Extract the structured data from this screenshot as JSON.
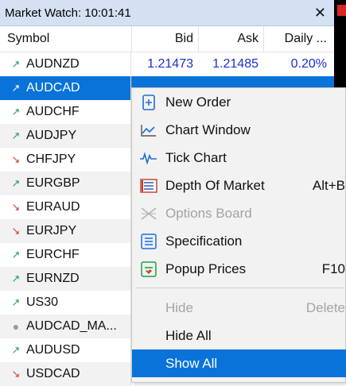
{
  "window": {
    "title": "Market Watch: 10:01:41",
    "close_icon": "close-icon"
  },
  "columns": {
    "symbol": "Symbol",
    "bid": "Bid",
    "ask": "Ask",
    "daily": "Daily ..."
  },
  "rows": [
    {
      "symbol": "AUDNZD",
      "dir": "up",
      "bid": "1.21473",
      "ask": "1.21485",
      "daily": "0.20%"
    },
    {
      "symbol": "AUDCAD",
      "dir": "up",
      "bid": "",
      "ask": "",
      "daily": "",
      "selected": true
    },
    {
      "symbol": "AUDCHF",
      "dir": "up"
    },
    {
      "symbol": "AUDJPY",
      "dir": "up"
    },
    {
      "symbol": "CHFJPY",
      "dir": "down"
    },
    {
      "symbol": "EURGBP",
      "dir": "up"
    },
    {
      "symbol": "EURAUD",
      "dir": "down"
    },
    {
      "symbol": "EURJPY",
      "dir": "down"
    },
    {
      "symbol": "EURCHF",
      "dir": "up"
    },
    {
      "symbol": "EURNZD",
      "dir": "up"
    },
    {
      "symbol": "US30",
      "dir": "up"
    },
    {
      "symbol": "AUDCAD_MA...",
      "dir": "none"
    },
    {
      "symbol": "AUDUSD",
      "dir": "up"
    },
    {
      "symbol": "USDCAD",
      "dir": "down"
    }
  ],
  "context_menu": {
    "items": [
      {
        "label": "New Order",
        "shortcut": "",
        "icon": "new-order-icon",
        "disabled": false
      },
      {
        "label": "Chart Window",
        "shortcut": "",
        "icon": "chart-window-icon",
        "disabled": false
      },
      {
        "label": "Tick Chart",
        "shortcut": "",
        "icon": "tick-chart-icon",
        "disabled": false
      },
      {
        "label": "Depth Of Market",
        "shortcut": "Alt+B",
        "icon": "depth-of-market-icon",
        "disabled": false
      },
      {
        "label": "Options Board",
        "shortcut": "",
        "icon": "options-board-icon",
        "disabled": true
      },
      {
        "label": "Specification",
        "shortcut": "",
        "icon": "specification-icon",
        "disabled": false
      },
      {
        "label": "Popup Prices",
        "shortcut": "F10",
        "icon": "popup-prices-icon",
        "disabled": false
      },
      {
        "label": "Hide",
        "shortcut": "Delete",
        "icon": "",
        "disabled": true
      },
      {
        "label": "Hide All",
        "shortcut": "",
        "icon": "",
        "disabled": false
      },
      {
        "label": "Show All",
        "shortcut": "",
        "icon": "",
        "disabled": false,
        "highlighted": true
      }
    ]
  },
  "colors": {
    "selection": "#0a73d9",
    "up": "#22a14a",
    "down": "#d23b2b",
    "price": "#1a2fcc"
  }
}
